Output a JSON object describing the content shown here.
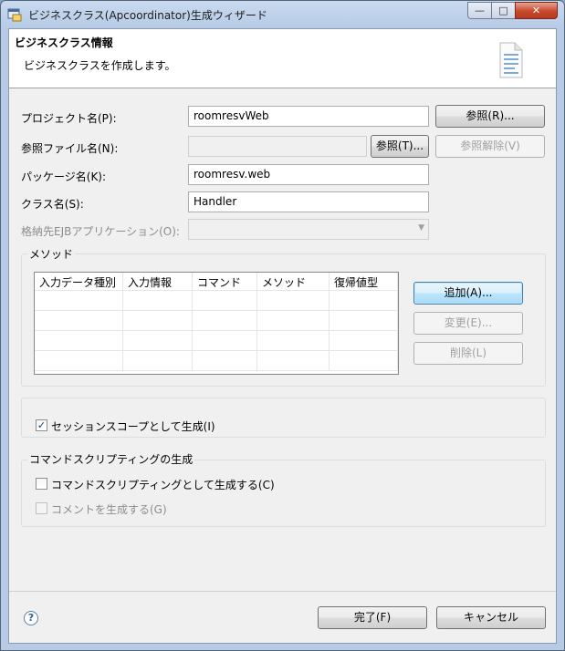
{
  "window": {
    "title": "ビジネスクラス(Apcoordinator)生成ウィザード",
    "controls": {
      "minimize": "—",
      "maximize": "□",
      "close": "✕"
    }
  },
  "header": {
    "title": "ビジネスクラス情報",
    "description": "ビジネスクラスを作成します。",
    "icon": "document-icon"
  },
  "form": {
    "project_label": "プロジェクト名(P):",
    "project_value": "roomresvWeb",
    "project_browse": "参照(R)...",
    "ref_file_label": "参照ファイル名(N):",
    "ref_file_value": "",
    "ref_file_browse": "参照(T)...",
    "ref_file_clear": "参照解除(V)",
    "package_label": "パッケージ名(K):",
    "package_value": "roomresv.web",
    "class_label": "クラス名(S):",
    "class_value": "Handler",
    "ejb_label": "格納先EJBアプリケーション(O):",
    "ejb_value": ""
  },
  "methods": {
    "group_title": "メソッド",
    "columns": [
      "入力データ種別",
      "入力情報",
      "コマンド",
      "メソッド",
      "復帰値型"
    ],
    "rows": [],
    "add_button": "追加(A)...",
    "edit_button": "変更(E)...",
    "delete_button": "削除(L)"
  },
  "session": {
    "checkbox_label": "セッションスコープとして生成(I)",
    "checked": true
  },
  "command_scripting": {
    "group_title": "コマンドスクリプティングの生成",
    "generate_label": "コマンドスクリプティングとして生成する(C)",
    "generate_checked": false,
    "comment_label": "コメントを生成する(G)",
    "comment_checked": false
  },
  "footer": {
    "help_icon": "?",
    "finish_button": "完了(F)",
    "cancel_button": "キャンセル"
  }
}
